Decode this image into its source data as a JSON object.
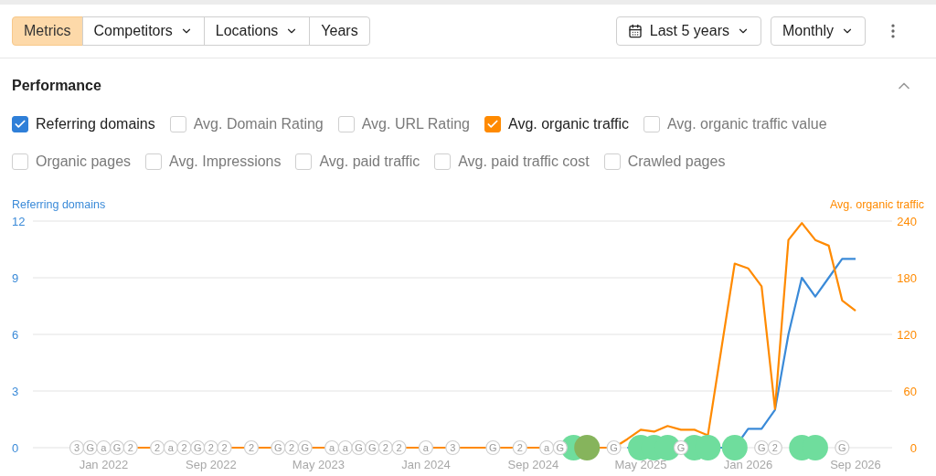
{
  "toolbar": {
    "segments": [
      {
        "label": "Metrics",
        "selected": true,
        "dropdown": false
      },
      {
        "label": "Competitors",
        "selected": false,
        "dropdown": true
      },
      {
        "label": "Locations",
        "selected": false,
        "dropdown": true
      },
      {
        "label": "Years",
        "selected": false,
        "dropdown": false
      }
    ],
    "period": "Last 5 years",
    "interval": "Monthly"
  },
  "performance": {
    "title": "Performance",
    "expanded": true,
    "metric_rows": [
      [
        {
          "label": "Referring domains",
          "checked": true,
          "color": "#2f7fd8"
        },
        {
          "label": "Avg. Domain Rating",
          "checked": false
        },
        {
          "label": "Avg. URL Rating",
          "checked": false
        },
        {
          "label": "Avg. organic traffic",
          "checked": true,
          "color": "#ff8a00"
        },
        {
          "label": "Avg. organic traffic value",
          "checked": false
        }
      ],
      [
        {
          "label": "Organic pages",
          "checked": false
        },
        {
          "label": "Avg. Impressions",
          "checked": false
        },
        {
          "label": "Avg. paid traffic",
          "checked": false
        },
        {
          "label": "Avg. paid traffic cost",
          "checked": false
        },
        {
          "label": "Crawled pages",
          "checked": false
        }
      ]
    ],
    "chart_data": {
      "type": "line",
      "grid": true,
      "ylim": [
        0,
        12
      ],
      "y2lim": [
        0,
        240
      ],
      "categories": [
        null,
        null,
        "Jan 2022",
        null,
        null,
        null,
        null,
        null,
        null,
        null,
        "Sep 2022",
        null,
        null,
        null,
        null,
        null,
        null,
        null,
        "May 2023",
        null,
        null,
        null,
        null,
        null,
        null,
        null,
        "Jan 2024",
        null,
        null,
        null,
        null,
        null,
        null,
        null,
        "Sep 2024",
        null,
        null,
        null,
        null,
        null,
        null,
        null,
        "May 2025",
        null,
        null,
        null,
        null,
        null,
        null,
        null,
        "Jan 2026",
        null,
        null,
        null,
        null,
        null,
        null,
        null,
        "Sep 2026"
      ],
      "yticks": [
        0,
        3,
        6,
        9,
        12
      ],
      "y2ticks": [
        0,
        60,
        120,
        180,
        240
      ],
      "series": [
        {
          "name": "Referring domains",
          "color": "#3a8ad8",
          "values": [
            null,
            null,
            null,
            null,
            null,
            null,
            null,
            null,
            null,
            null,
            null,
            null,
            null,
            null,
            null,
            null,
            null,
            null,
            null,
            null,
            null,
            null,
            null,
            null,
            null,
            null,
            null,
            null,
            null,
            null,
            null,
            null,
            null,
            null,
            null,
            null,
            null,
            null,
            null,
            null,
            null,
            0,
            0,
            0,
            0,
            0,
            0,
            0,
            0,
            0,
            1,
            1,
            2,
            6,
            9,
            8,
            9,
            10,
            10
          ]
        },
        {
          "name": "Avg. organic traffic",
          "axis": "y2",
          "color": "#ff8a00",
          "values": [
            null,
            null,
            null,
            0,
            0,
            0,
            0,
            0,
            0,
            0,
            0,
            0,
            0,
            0,
            0,
            0,
            0,
            0,
            0,
            0,
            0,
            0,
            0,
            0,
            0,
            0,
            0,
            0,
            0,
            0,
            0,
            0,
            0,
            0,
            0,
            0,
            0,
            0,
            0,
            0,
            0,
            9,
            19,
            17,
            23,
            19,
            19,
            13,
            104,
            195,
            190,
            171,
            41,
            220,
            238,
            220,
            214,
            156,
            145
          ]
        }
      ]
    },
    "event_markers": [
      {
        "kind": "note",
        "text": "3"
      },
      {
        "kind": "note",
        "text": "G"
      },
      {
        "kind": "note",
        "text": "a"
      },
      {
        "kind": "note",
        "text": "G"
      },
      {
        "kind": "note",
        "text": "2"
      },
      {
        "kind": "gap"
      },
      {
        "kind": "note",
        "text": "2"
      },
      {
        "kind": "note",
        "text": "a"
      },
      {
        "kind": "note",
        "text": "2"
      },
      {
        "kind": "note",
        "text": "G"
      },
      {
        "kind": "note",
        "text": "2"
      },
      {
        "kind": "note",
        "text": "2"
      },
      {
        "kind": "gap"
      },
      {
        "kind": "note",
        "text": "2"
      },
      {
        "kind": "gap"
      },
      {
        "kind": "note",
        "text": "G"
      },
      {
        "kind": "note",
        "text": "2"
      },
      {
        "kind": "note",
        "text": "G"
      },
      {
        "kind": "gap"
      },
      {
        "kind": "note",
        "text": "a"
      },
      {
        "kind": "note",
        "text": "a"
      },
      {
        "kind": "note",
        "text": "G"
      },
      {
        "kind": "note",
        "text": "G"
      },
      {
        "kind": "note",
        "text": "2"
      },
      {
        "kind": "note",
        "text": "2"
      },
      {
        "kind": "gap"
      },
      {
        "kind": "note",
        "text": "a"
      },
      {
        "kind": "gap"
      },
      {
        "kind": "note",
        "text": "3"
      },
      {
        "kind": "gap"
      },
      {
        "kind": "gap"
      },
      {
        "kind": "note",
        "text": "G"
      },
      {
        "kind": "gap"
      },
      {
        "kind": "note",
        "text": "2"
      },
      {
        "kind": "gap"
      },
      {
        "kind": "note",
        "text": "a"
      },
      {
        "kind": "note",
        "text": "G"
      },
      {
        "kind": "highlight",
        "color": "#6fdd9d"
      },
      {
        "kind": "highlight",
        "color": "#86b45c"
      },
      {
        "kind": "gap"
      },
      {
        "kind": "note",
        "text": "G"
      },
      {
        "kind": "gap"
      },
      {
        "kind": "highlight",
        "color": "#6fdd9d"
      },
      {
        "kind": "highlight",
        "color": "#6fdd9d"
      },
      {
        "kind": "highlight",
        "color": "#6fdd9d"
      },
      {
        "kind": "note",
        "text": "G"
      },
      {
        "kind": "highlight",
        "color": "#6fdd9d"
      },
      {
        "kind": "highlight",
        "color": "#6fdd9d"
      },
      {
        "kind": "gap"
      },
      {
        "kind": "highlight",
        "color": "#6fdd9d"
      },
      {
        "kind": "gap"
      },
      {
        "kind": "note",
        "text": "G"
      },
      {
        "kind": "note",
        "text": "2"
      },
      {
        "kind": "gap"
      },
      {
        "kind": "highlight",
        "color": "#6fdd9d"
      },
      {
        "kind": "highlight",
        "color": "#6fdd9d"
      },
      {
        "kind": "gap"
      },
      {
        "kind": "note",
        "text": "G"
      }
    ]
  }
}
